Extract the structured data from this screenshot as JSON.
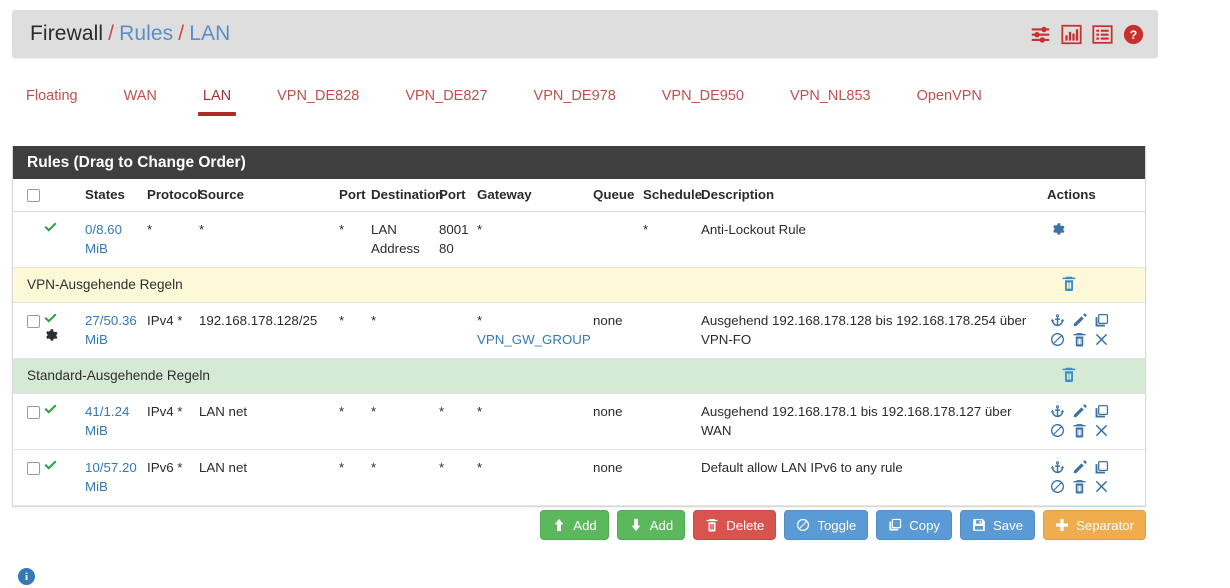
{
  "breadcrumb": {
    "level1": "Firewall",
    "level2": "Rules",
    "level3": "LAN",
    "separator": "/"
  },
  "header_icons": [
    {
      "name": "filter-icon",
      "label": "Advanced Filter"
    },
    {
      "name": "chart-icon",
      "label": "Traffic Graph"
    },
    {
      "name": "log-icon",
      "label": "Firewall Log"
    },
    {
      "name": "help-icon",
      "label": "Help"
    }
  ],
  "tabs": [
    {
      "label": "Floating",
      "active": false
    },
    {
      "label": "WAN",
      "active": false
    },
    {
      "label": "LAN",
      "active": true
    },
    {
      "label": "VPN_DE828",
      "active": false
    },
    {
      "label": "VPN_DE827",
      "active": false
    },
    {
      "label": "VPN_DE978",
      "active": false
    },
    {
      "label": "VPN_DE950",
      "active": false
    },
    {
      "label": "VPN_NL853",
      "active": false
    },
    {
      "label": "OpenVPN",
      "active": false
    }
  ],
  "panel": {
    "title": "Rules (Drag to Change Order)",
    "columns": {
      "states": "States",
      "protocol": "Protocol",
      "source": "Source",
      "port_src": "Port",
      "destination": "Destination",
      "port_dst": "Port",
      "gateway": "Gateway",
      "queue": "Queue",
      "schedule": "Schedule",
      "description": "Description",
      "actions": "Actions"
    }
  },
  "rows": [
    {
      "type": "rule",
      "has_checkbox": false,
      "status": "pass",
      "has_advanced_gear": false,
      "states": "0/8.60 MiB",
      "protocol": "*",
      "source": "*",
      "port_src": "*",
      "destination": "LAN Address",
      "port_dst": "8001 80",
      "gateway": "*",
      "queue": "",
      "schedule": "*",
      "description": "Anti-Lockout Rule",
      "actions": [
        "gear-blue"
      ]
    },
    {
      "type": "separator",
      "color": "yellow",
      "label": "VPN-Ausgehende Regeln"
    },
    {
      "type": "rule",
      "has_checkbox": true,
      "status": "pass",
      "has_advanced_gear": true,
      "states": "27/50.36 MiB",
      "protocol": "IPv4 *",
      "source": "192.168.178.128/25",
      "port_src": "*",
      "destination": "*",
      "port_dst": "",
      "gateway_port": "*",
      "gateway": "VPN_GW_GROUP",
      "queue": "none",
      "schedule": "",
      "description": "Ausgehend 192.168.178.128 bis 192.168.178.254 über VPN-FO",
      "actions": [
        "anchor",
        "edit",
        "copy",
        "block",
        "delete",
        "close"
      ]
    },
    {
      "type": "separator",
      "color": "green",
      "label": "Standard-Ausgehende Regeln"
    },
    {
      "type": "rule",
      "has_checkbox": true,
      "status": "pass",
      "has_advanced_gear": false,
      "states": "41/1.24 MiB",
      "protocol": "IPv4 *",
      "source": "LAN net",
      "port_src": "*",
      "destination": "*",
      "port_dst": "*",
      "gateway": "*",
      "queue": "none",
      "schedule": "",
      "description": "Ausgehend 192.168.178.1 bis 192.168.178.127 über WAN",
      "actions": [
        "anchor",
        "edit",
        "copy",
        "block",
        "delete",
        "close"
      ]
    },
    {
      "type": "rule",
      "has_checkbox": true,
      "status": "pass",
      "has_advanced_gear": false,
      "states": "10/57.20 MiB",
      "protocol": "IPv6 *",
      "source": "LAN net",
      "port_src": "*",
      "destination": "*",
      "port_dst": "*",
      "gateway": "*",
      "queue": "none",
      "schedule": "",
      "description": "Default allow LAN IPv6 to any rule",
      "actions": [
        "anchor",
        "edit",
        "copy",
        "block",
        "delete",
        "close"
      ]
    }
  ],
  "buttons": [
    {
      "label": "Add",
      "icon": "arrow-up-icon",
      "style": "green"
    },
    {
      "label": "Add",
      "icon": "arrow-down-icon",
      "style": "green"
    },
    {
      "label": "Delete",
      "icon": "trash-icon",
      "style": "red"
    },
    {
      "label": "Toggle",
      "icon": "ban-icon",
      "style": "blue"
    },
    {
      "label": "Copy",
      "icon": "copy-icon",
      "style": "blue"
    },
    {
      "label": "Save",
      "icon": "save-icon",
      "style": "blue"
    },
    {
      "label": "Separator",
      "icon": "plus-icon",
      "style": "orange"
    }
  ],
  "footer": {
    "info_label": "i"
  },
  "colors": {
    "accent_red": "#c9302c",
    "link_blue": "#337ab7",
    "pass_green": "#2aa03f",
    "separator_yellow": "#fcf8d8",
    "separator_green": "#d5ead5",
    "panel_header": "#3f3f3f"
  }
}
